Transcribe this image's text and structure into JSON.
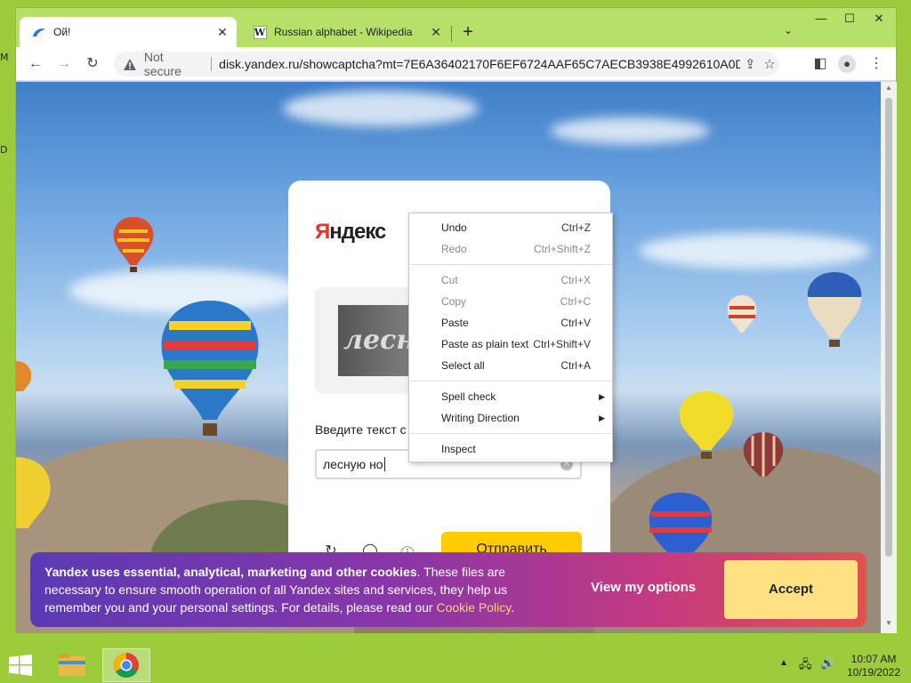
{
  "desktop": {
    "glyph_top": "M",
    "glyph_bottom": "D"
  },
  "browser": {
    "tabs": [
      {
        "title": "Ой!",
        "active": true
      },
      {
        "title": "Russian alphabet - Wikipedia",
        "active": false
      }
    ],
    "security_label": "Not secure",
    "url": "disk.yandex.ru/showcaptcha?mt=7E6A36402170F6EF6724AAF65C7AECB3938E4992610A0D8..."
  },
  "page": {
    "logo": {
      "first": "Я",
      "rest": "ндекс"
    },
    "captcha_text": "лесн",
    "prompt": "Введите текст с",
    "answer_value": "лесную но",
    "submit_label": "Отправить"
  },
  "cookie_banner": {
    "bold": "Yandex uses essential, analytical, marketing and other cookies",
    "text": ". These files are necessary to ensure smooth operation of all Yandex sites and services, they help us remember you and your personal settings. For details, please read our ",
    "link": "Cookie Policy",
    "end": ".",
    "options_label": "View my options",
    "accept_label": "Accept"
  },
  "context_menu": {
    "items": [
      {
        "label": "Undo",
        "shortcut": "Ctrl+Z"
      },
      {
        "label": "Redo",
        "shortcut": "Ctrl+Shift+Z"
      },
      {
        "label": "Cut",
        "shortcut": "Ctrl+X"
      },
      {
        "label": "Copy",
        "shortcut": "Ctrl+C"
      },
      {
        "label": "Paste",
        "shortcut": "Ctrl+V"
      },
      {
        "label": "Paste as plain text",
        "shortcut": "Ctrl+Shift+V"
      },
      {
        "label": "Select all",
        "shortcut": "Ctrl+A"
      },
      {
        "label": "Spell check",
        "shortcut": ""
      },
      {
        "label": "Writing Direction",
        "shortcut": ""
      },
      {
        "label": "Inspect",
        "shortcut": ""
      }
    ]
  },
  "taskbar": {
    "time": "10:07 AM",
    "date": "10/19/2022"
  }
}
